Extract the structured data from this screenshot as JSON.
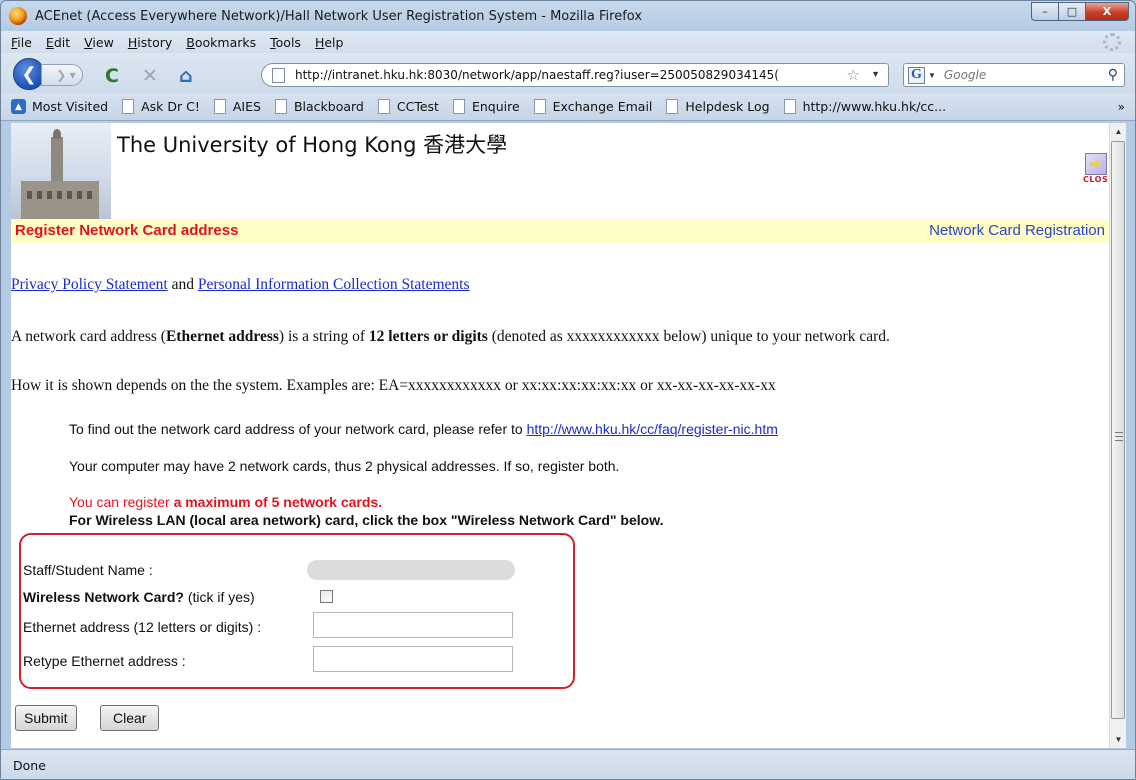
{
  "window": {
    "title": "ACEnet (Access Everywhere Network)/Hall Network User Registration System - Mozilla Firefox",
    "minimize": "–",
    "maximize": "□",
    "close": "X"
  },
  "menu": [
    "File",
    "Edit",
    "View",
    "History",
    "Bookmarks",
    "Tools",
    "Help"
  ],
  "nav": {
    "url": "http://intranet.hku.hk:8030/network/app/naestaff.reg?iuser=250050829034145(",
    "search_placeholder": "Google",
    "search_engine_letter": "G"
  },
  "bookmarks": {
    "most_visited": "Most Visited",
    "items": [
      "Ask Dr C!",
      "AIES",
      "Blackboard",
      "CCTest",
      "Enquire",
      "Exchange Email",
      "Helpdesk Log",
      "http://www.hku.hk/cc..."
    ],
    "more": "»"
  },
  "page": {
    "university": "The University of Hong Kong 香港大學",
    "close_label": "CLOSE",
    "heading_left": "Register Network Card address",
    "heading_right": "Network Card Registration",
    "privacy_link": "Privacy Policy Statement",
    "and": " and ",
    "pics_link": "Personal Information Collection Statements",
    "p1_a": "A network card address (",
    "p1_b": "Ethernet address",
    "p1_c": ") is a string of ",
    "p1_d": "12 letters or digits",
    "p1_e": " (denoted as xxxxxxxxxxxx below) unique to your network card.",
    "p2": "How it is shown depends on the the system.  Examples are:  EA=xxxxxxxxxxxx  or   xx:xx:xx:xx:xx:xx  or   xx-xx-xx-xx-xx-xx",
    "find_text": "To find out the network card address of your network card, please refer to ",
    "find_link": "http://www.hku.hk/cc/faq/register-nic.htm",
    "two_cards": "Your computer may have 2 network cards, thus 2 physical addresses.  If so, register both.",
    "max_a": "You can register ",
    "max_b": "a maximum of 5 network cards.",
    "wireless_note": "For Wireless LAN (local area network) card, click the box \"Wireless Network Card\" below."
  },
  "form": {
    "name_label": "Staff/Student Name :",
    "wireless_label_bold": "Wireless Network Card?",
    "wireless_label_rest": " (tick if yes)",
    "ethernet_label": "Ethernet address (12 letters or digits) :",
    "retype_label": "Retype Ethernet address :",
    "ethernet_value": "",
    "retype_value": "",
    "submit": "Submit",
    "clear": "Clear"
  },
  "status": "Done"
}
